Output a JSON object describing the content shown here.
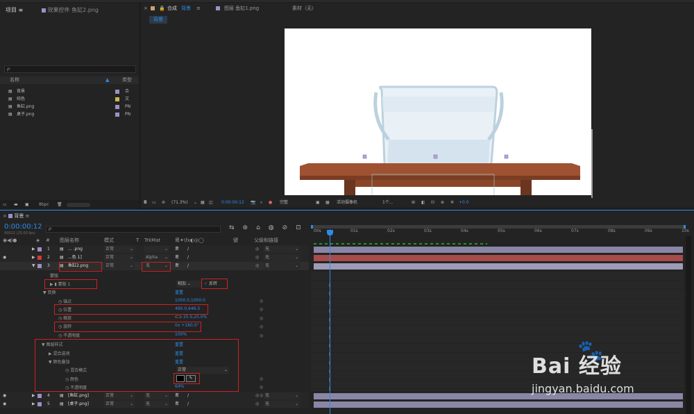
{
  "project": {
    "tab": "项目",
    "search_placeholder": "ρ·",
    "col_name": "名称",
    "col_type": "类型",
    "items": [
      {
        "name": "背景",
        "type": "合",
        "color": "#9d8fc6"
      },
      {
        "name": "纯色",
        "type": "文",
        "color": "#c9b84a"
      },
      {
        "name": "鱼缸.png",
        "type": "PN",
        "color": "#9d8fc6"
      },
      {
        "name": "桌子.png",
        "type": "PN",
        "color": "#9d8fc6"
      }
    ],
    "bpc": "8bpc"
  },
  "effects_tab": "效果控件 鱼缸2.png",
  "comp": {
    "tab_lock": "合成",
    "tab_name": "背景",
    "layer_tab": "图层 鱼缸1.png",
    "footage_tab": "素材（无）",
    "breadcrumb": "背景"
  },
  "viewer": {
    "zoom": "(71.3%)",
    "time": "0:00:00:12",
    "quality": "完整",
    "camera": "活动摄像机",
    "views": "1个...",
    "exposure": "+0.0"
  },
  "timeline": {
    "tab": "背景",
    "timecode": "0:00:00:12",
    "fps": "00012 (25.00 fps)",
    "search_placeholder": "ρ·",
    "headers": {
      "name": "图层名称",
      "mode": "模式",
      "t": "T",
      "trkmat": "TrkMat",
      "key": "键",
      "parent": "父级和链接"
    },
    "ruler": [
      "00s",
      "01s",
      "02s",
      "03s",
      "04s",
      "05s",
      "06s",
      "07s",
      "08s",
      "09s",
      "10s"
    ],
    "layers": [
      {
        "num": "1",
        "name": "... .png",
        "mode": "正常",
        "trkmat": "",
        "parent": "无",
        "color": "#9d8fc6"
      },
      {
        "num": "2",
        "name": "...色 1]",
        "mode": "正常",
        "trkmat": "Alpha",
        "parent": "无",
        "color": "#d23a3a"
      },
      {
        "num": "3",
        "name": "鱼缸2.png",
        "mode": "正常",
        "trkmat": "无",
        "parent": "无",
        "color": "#9d8fc6"
      },
      {
        "num": "4",
        "name": "[鱼缸.png]",
        "mode": "正常",
        "trkmat": "无",
        "parent": "无",
        "color": "#9d8fc6"
      },
      {
        "num": "5",
        "name": "[桌子.png]",
        "mode": "正常",
        "trkmat": "无",
        "parent": "无",
        "color": "#9d8fc6"
      }
    ],
    "props": {
      "mask_group": "蒙版",
      "mask1": "蒙版 1",
      "mask_mode": "相加",
      "invert_label": "反转",
      "transform": "变换",
      "reset": "重置",
      "anchor_label": "锚点",
      "anchor_val": "1000.0,1000.0",
      "position_label": "位置",
      "position_val": "490.0,646.5",
      "scale_label": "缩放",
      "scale_val": "25.0,25.0%",
      "rotation_label": "旋转",
      "rotation_val": "0x +180.0°",
      "opacity_label": "不透明度",
      "opacity_val": "100%",
      "layer_styles": "图层样式",
      "blend_options": "混合选项",
      "color_overlay": "颜色叠加",
      "blend_mode_label": "混合模式",
      "blend_mode_val": "正常",
      "color_label": "颜色",
      "overlay_opacity_label": "不透明度",
      "overlay_opacity_val": "64%"
    }
  },
  "watermark": {
    "brand": "Bai 经验",
    "url": "jingyan.baidu.com"
  }
}
